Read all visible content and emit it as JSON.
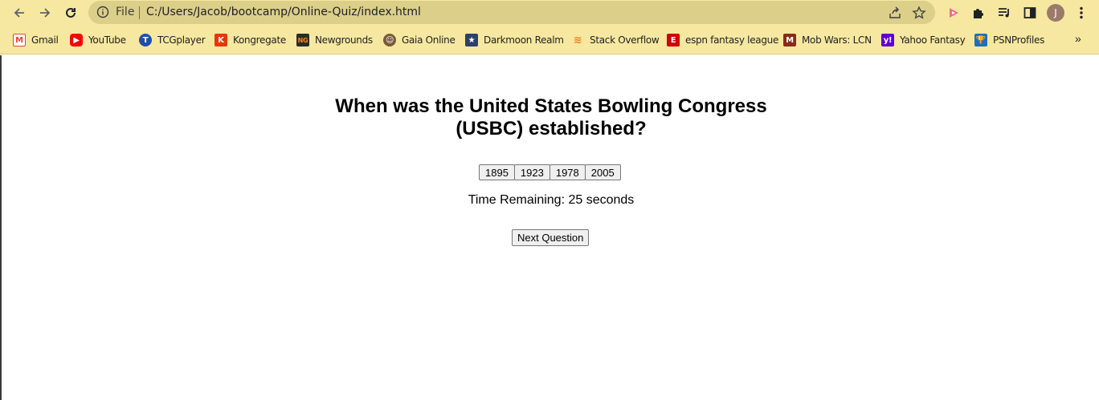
{
  "browser": {
    "file_label": "File",
    "url": "C:/Users/Jacob/bootcamp/Online-Quiz/index.html",
    "avatar_initial": "J",
    "bookmarks": [
      {
        "label": "Gmail",
        "icon": "gmail-icon",
        "color": "#ea4335"
      },
      {
        "label": "YouTube",
        "icon": "youtube-icon",
        "color": "#ff0000"
      },
      {
        "label": "TCGplayer",
        "icon": "tcgplayer-icon",
        "color": "#1f4fa8"
      },
      {
        "label": "Kongregate",
        "icon": "kongregate-icon",
        "color": "#e4380c"
      },
      {
        "label": "Newgrounds",
        "icon": "newgrounds-icon",
        "color": "#f28c00"
      },
      {
        "label": "Gaia Online",
        "icon": "gaia-online-icon",
        "color": "#7a5a3a"
      },
      {
        "label": "Darkmoon Realm",
        "icon": "darkmoon-realm-icon",
        "color": "#2e3f6e"
      },
      {
        "label": "Stack Overflow",
        "icon": "stack-overflow-icon",
        "color": "#f48024"
      },
      {
        "label": "espn fantasy league",
        "icon": "espn-icon",
        "color": "#d00000"
      },
      {
        "label": "Mob Wars: LCN",
        "icon": "mob-wars-icon",
        "color": "#8a2b1a"
      },
      {
        "label": "Yahoo Fantasy",
        "icon": "yahoo-icon",
        "color": "#6001d2"
      },
      {
        "label": "PSNProfiles",
        "icon": "psnprofiles-icon",
        "color": "#1d6fb8"
      }
    ],
    "more_label": "»"
  },
  "quiz": {
    "question": "When was the United States Bowling Congress (USBC) established?",
    "answers": [
      "1895",
      "1923",
      "1978",
      "2005"
    ],
    "timer_text": "Time Remaining: 25 seconds",
    "next_label": "Next Question"
  }
}
